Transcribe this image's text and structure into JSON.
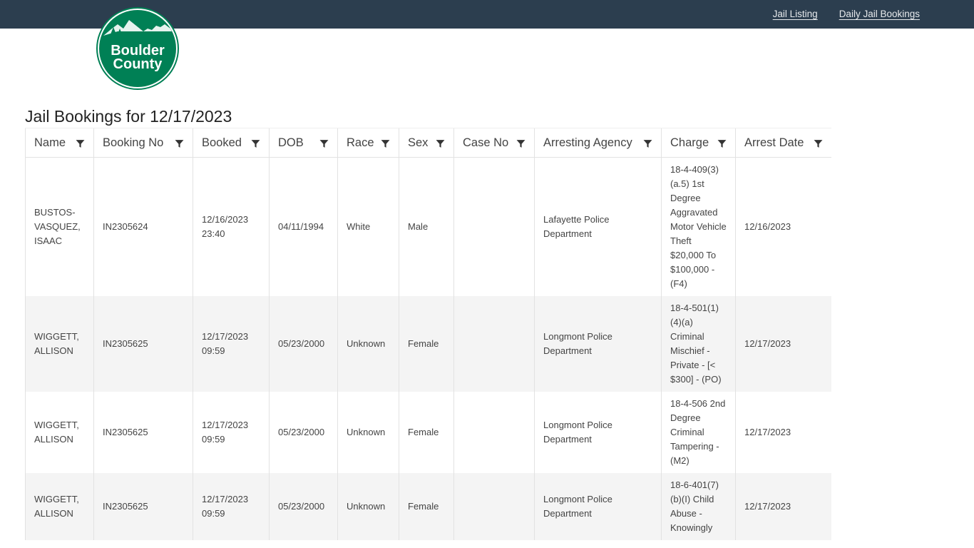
{
  "nav": {
    "links": [
      {
        "label": "Jail Listing"
      },
      {
        "label": "Daily Jail Bookings"
      }
    ]
  },
  "logo": {
    "line1": "Boulder",
    "line2": "County",
    "color": "#008055"
  },
  "page": {
    "title": "Jail Bookings for 12/17/2023"
  },
  "table": {
    "columns": [
      {
        "label": "Name"
      },
      {
        "label": "Booking No"
      },
      {
        "label": "Booked"
      },
      {
        "label": "DOB"
      },
      {
        "label": "Race"
      },
      {
        "label": "Sex"
      },
      {
        "label": "Case No"
      },
      {
        "label": "Arresting Agency"
      },
      {
        "label": "Charge"
      },
      {
        "label": "Arrest Date"
      }
    ],
    "rows": [
      {
        "name": "BUSTOS-VASQUEZ, ISAAC",
        "booking_no": "IN2305624",
        "booked": "12/16/2023 23:40",
        "dob": "04/11/1994",
        "race": "White",
        "sex": "Male",
        "case_no": "",
        "agency": "Lafayette Police Department",
        "charge": "18-4-409(3)(a.5) 1st Degree Aggravated Motor Vehicle Theft $20,000 To $100,000 - (F4)",
        "arrest_date": "12/16/2023"
      },
      {
        "name": "WIGGETT, ALLISON",
        "booking_no": "IN2305625",
        "booked": "12/17/2023 09:59",
        "dob": "05/23/2000",
        "race": "Unknown",
        "sex": "Female",
        "case_no": "",
        "agency": "Longmont Police Department",
        "charge": "18-4-501(1)(4)(a) Criminal Mischief - Private - [< $300] - (PO)",
        "arrest_date": "12/17/2023"
      },
      {
        "name": "WIGGETT, ALLISON",
        "booking_no": "IN2305625",
        "booked": "12/17/2023 09:59",
        "dob": "05/23/2000",
        "race": "Unknown",
        "sex": "Female",
        "case_no": "",
        "agency": "Longmont Police Department",
        "charge": "18-4-506 2nd Degree Criminal Tampering - (M2)",
        "arrest_date": "12/17/2023"
      },
      {
        "name": "WIGGETT, ALLISON",
        "booking_no": "IN2305625",
        "booked": "12/17/2023 09:59",
        "dob": "05/23/2000",
        "race": "Unknown",
        "sex": "Female",
        "case_no": "",
        "agency": "Longmont Police Department",
        "charge": "18-6-401(7)(b)(I) Child Abuse - Knowingly",
        "arrest_date": "12/17/2023"
      }
    ]
  }
}
